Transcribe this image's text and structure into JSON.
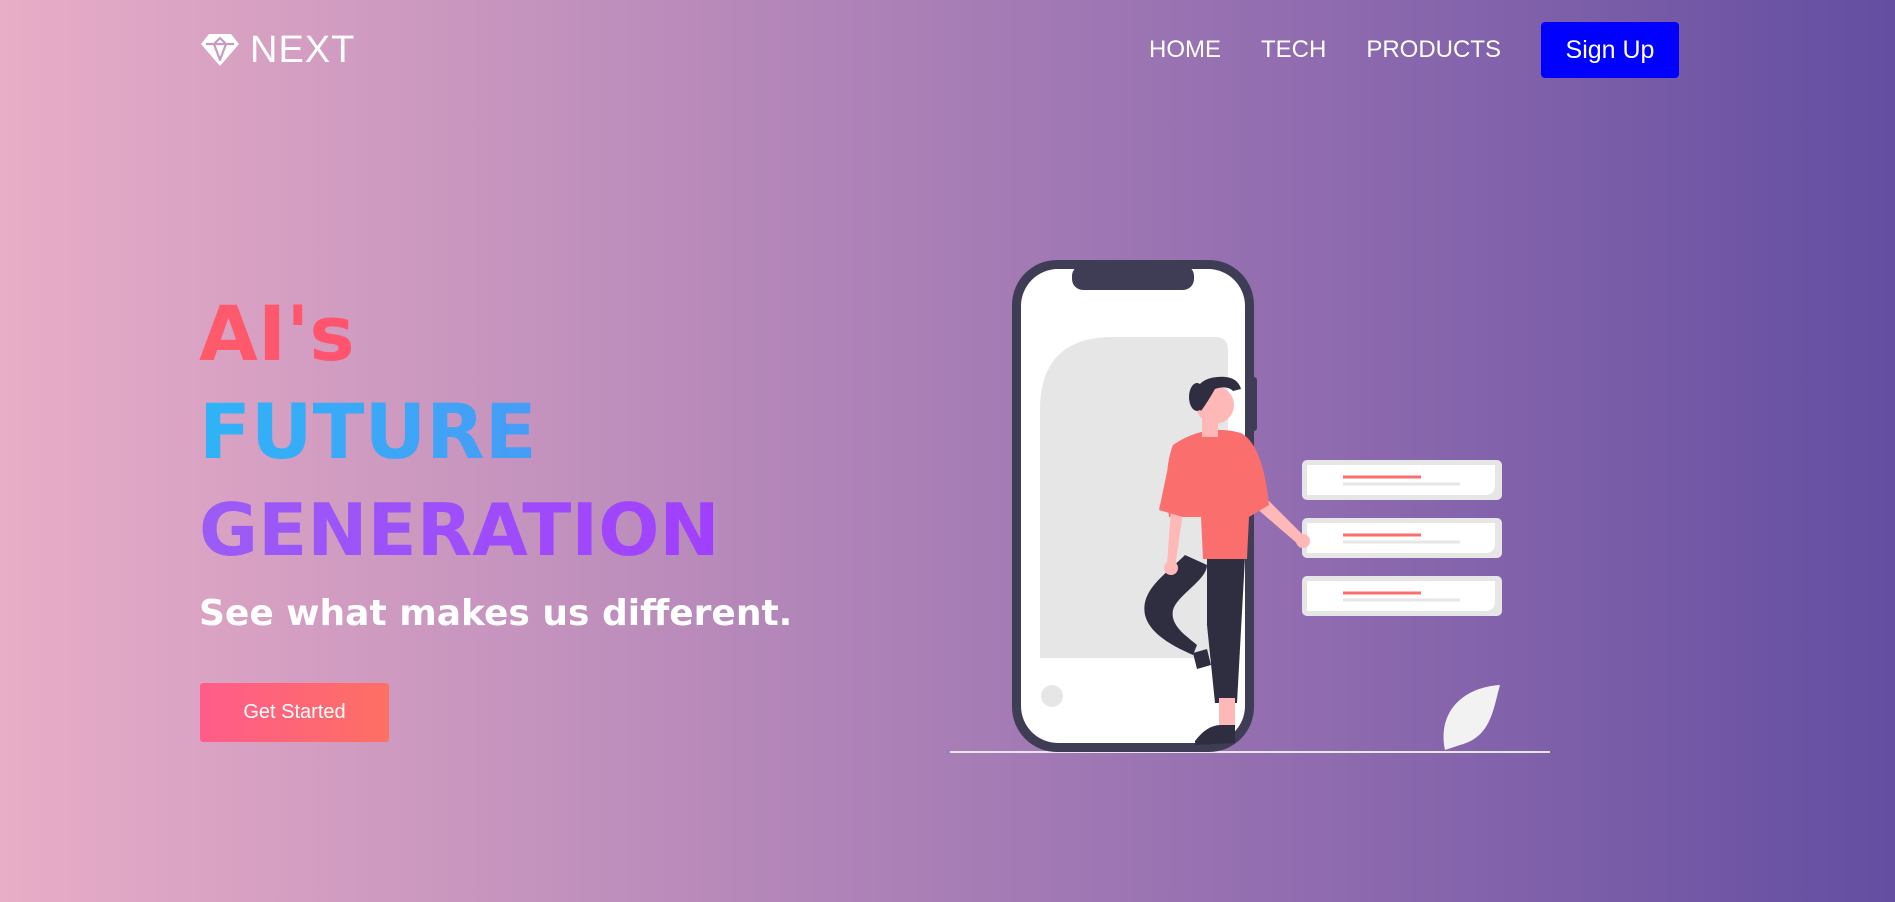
{
  "header": {
    "logo_text": "NEXT",
    "nav": [
      {
        "label": "HOME"
      },
      {
        "label": "TECH"
      },
      {
        "label": "PRODUCTS"
      }
    ],
    "signup_label": "Sign Up"
  },
  "hero": {
    "headline": [
      "AI's",
      "FUTURE",
      "GENERATION"
    ],
    "tagline": "See what makes us different.",
    "cta_label": "Get Started"
  },
  "colors": {
    "signup_button": "#0000ff",
    "headline_line1": "#ff4a6e",
    "headline_line2": "#3ea6f7",
    "headline_line3": "#9d4df8",
    "cta_gradient_start": "#ff5c8a",
    "cta_gradient_end": "#fe6f63"
  },
  "icons": {
    "logo": "diamond-icon",
    "illustration": "person-with-phone-illustration"
  }
}
